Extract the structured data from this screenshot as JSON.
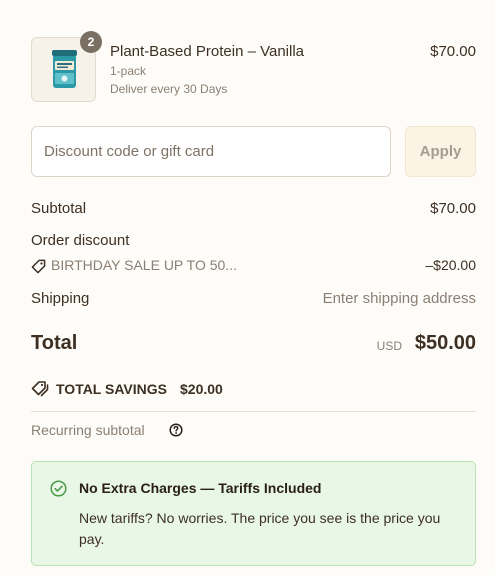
{
  "product": {
    "quantity": "2",
    "name": "Plant-Based Protein – Vanilla",
    "price": "$70.00",
    "pack": "1-pack",
    "delivery": "Deliver every 30 Days",
    "image_icon": "protein-tub-icon"
  },
  "discount": {
    "placeholder": "Discount code or gift card",
    "value": "",
    "apply_label": "Apply"
  },
  "summary": {
    "subtotal_label": "Subtotal",
    "subtotal_value": "$70.00",
    "order_discount_label": "Order discount",
    "discount_code": "BIRTHDAY SALE UP TO 50...",
    "discount_amount": "–$20.00",
    "shipping_label": "Shipping",
    "shipping_value": "Enter shipping address",
    "total_label": "Total",
    "total_currency": "USD",
    "total_value": "$50.00",
    "savings_label": "TOTAL SAVINGS",
    "savings_value": "$20.00",
    "recurring_label": "Recurring subtotal"
  },
  "notice": {
    "title": "No Extra Charges — Tariffs Included",
    "body": "New tariffs? No worries. The price you see is the price you pay."
  },
  "colors": {
    "text": "#3d2f22",
    "muted": "#8b7f73",
    "notice_bg": "#e9f7e7",
    "notice_border": "#b8e2b3",
    "check": "#4c9a48"
  }
}
